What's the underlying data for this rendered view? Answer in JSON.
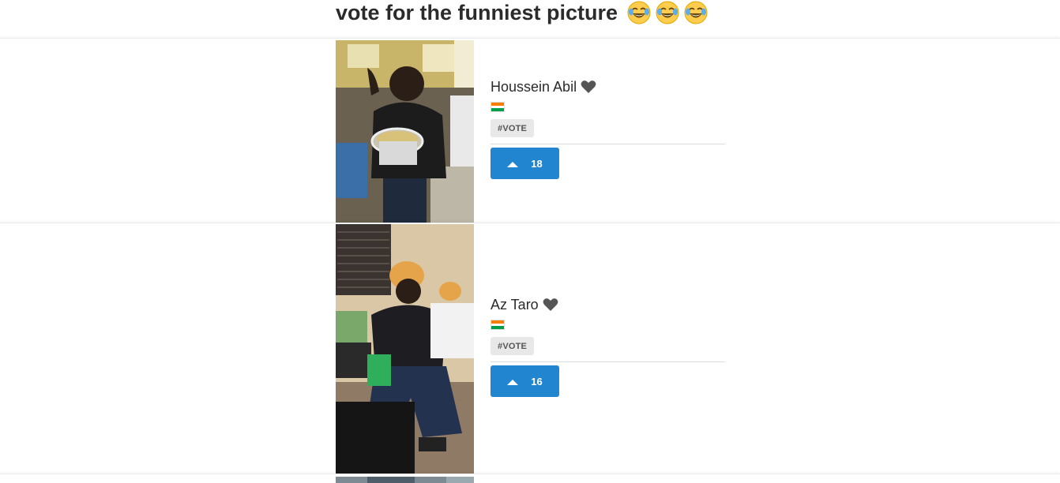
{
  "header": {
    "title": "vote for the funniest picture",
    "emoji_icons": [
      "face-with-tears-of-joy-icon",
      "face-with-tears-of-joy-icon",
      "face-with-tears-of-joy-icon"
    ]
  },
  "entries": [
    {
      "name": "Houssein Abil",
      "heart_icon": "heart-icon",
      "flag_icon": "flag-icon",
      "tag": "#VOTE",
      "votes": "18",
      "vote_icon": "caret-up-icon"
    },
    {
      "name": "Az Taro",
      "heart_icon": "heart-icon",
      "flag_icon": "flag-icon",
      "tag": "#VOTE",
      "votes": "16",
      "vote_icon": "caret-up-icon"
    }
  ],
  "colors": {
    "vote_button": "#2185d0",
    "tag_bg": "#e8e8e8",
    "heart": "#555555"
  }
}
